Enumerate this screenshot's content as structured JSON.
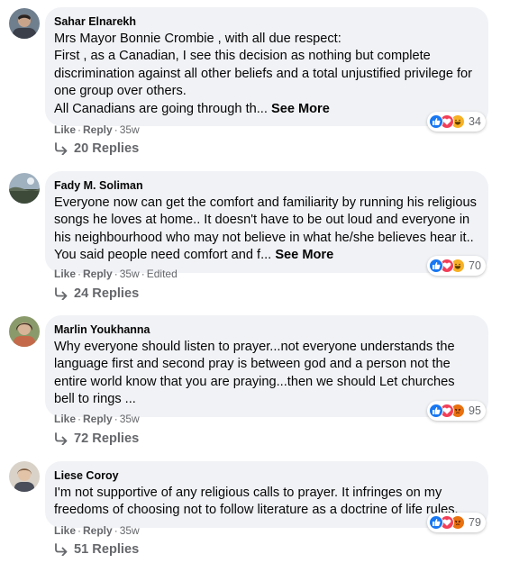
{
  "comments": [
    {
      "author": "Sahar Elnarekh",
      "text": "Mrs Mayor Bonnie Crombie , with all due respect:\nFirst , as a Canadian, I see this decision as nothing but complete discrimination against all other beliefs and a total unjustified privilege for one group over others.\nAll Canadians are going through th...",
      "see_more": "See More",
      "reaction_count": "34",
      "reactions": [
        "like-icon",
        "love-icon",
        "haha-icon"
      ],
      "like": "Like",
      "reply": "Reply",
      "time": "35w",
      "edited": "",
      "replies": "20 Replies"
    },
    {
      "author": "Fady M. Soliman",
      "text": "Everyone now can get the comfort and familiarity by running his religious songs he loves at home.. It doesn't have to be out loud and everyone in his neighbourhood who may not believe in what he/she believes hear it.. You said people need comfort and f...",
      "see_more": "See More",
      "reaction_count": "70",
      "reactions": [
        "like-icon",
        "love-icon",
        "haha-icon"
      ],
      "like": "Like",
      "reply": "Reply",
      "time": "35w",
      "edited": "Edited",
      "replies": "24 Replies"
    },
    {
      "author": "Marlin Youkhanna",
      "text": "Why everyone should listen to prayer...not everyone understands the language first and second pray is between god and a person not the entire world know that you are praying...then we should Let churches bell to rings ...",
      "see_more": "",
      "reaction_count": "95",
      "reactions": [
        "like-icon",
        "love-icon",
        "angry-icon"
      ],
      "like": "Like",
      "reply": "Reply",
      "time": "35w",
      "edited": "",
      "replies": "72 Replies"
    },
    {
      "author": "Liese Coroy",
      "text": "I'm not supportive of any religious calls to prayer. It infringes on my freedoms of choosing not to follow literature as a doctrine of life rules.",
      "see_more": "",
      "reaction_count": "79",
      "reactions": [
        "like-icon",
        "love-icon",
        "angry-icon"
      ],
      "like": "Like",
      "reply": "Reply",
      "time": "35w",
      "edited": "",
      "replies": "51 Replies"
    }
  ],
  "colors": {
    "bubble": "#f0f2f5",
    "meta": "#65676b",
    "like": "#1877f2",
    "love": "#f33e58",
    "haha": "#f7b125",
    "angry": "#e9710f"
  }
}
